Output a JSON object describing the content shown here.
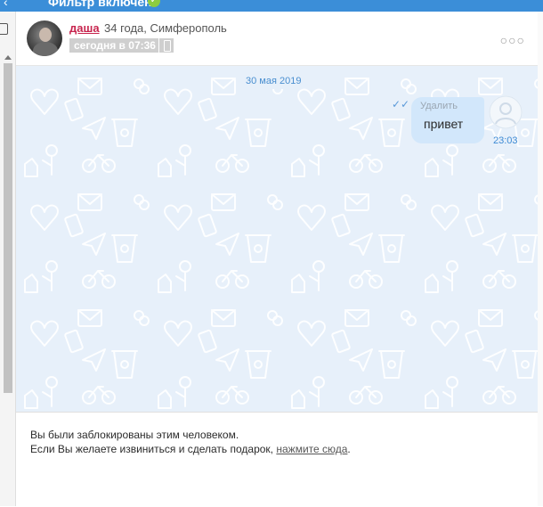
{
  "topbar": {
    "title": "Фильтр включен",
    "badge": "✓"
  },
  "header": {
    "username": "даша",
    "meta": "34 года, Симферополь",
    "status": "сегодня в 07:36",
    "more_icon": "more-horizontal-icon"
  },
  "chat": {
    "date": "30 мая 2019",
    "message": {
      "delete_label": "Удалить",
      "text": "привет",
      "time": "23:03"
    }
  },
  "notice": {
    "line1": "Вы были заблокированы этим человеком.",
    "line2_prefix": "Если Вы желаете извиниться и сделать подарок, ",
    "link_text": "нажмите сюда",
    "line2_suffix": "."
  },
  "colors": {
    "topbar": "#3b8ed8",
    "chat_bg": "#e7f0fa",
    "bubble": "#d2e7fb",
    "username": "#c7254e",
    "accent": "#3d8ad4"
  }
}
